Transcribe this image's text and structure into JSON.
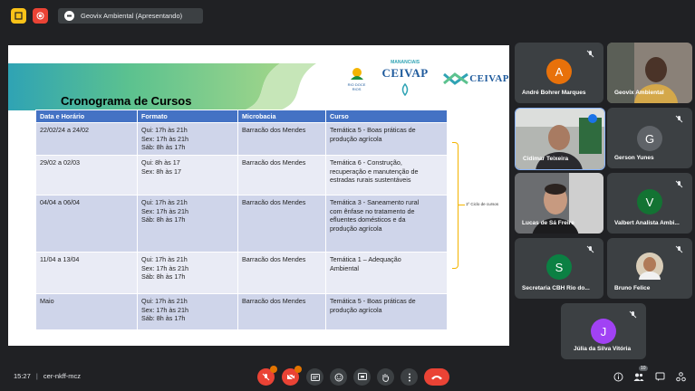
{
  "meeting": {
    "presenter_label": "Geovix Ambiental (Apresentando)",
    "time": "15:27",
    "code": "cer-nkff-mcz",
    "participant_count": "10"
  },
  "slide": {
    "title": "Cronograma de Cursos",
    "logos": {
      "rio_doce": "RIO DOCE RIOS",
      "mananciais": "MANANCIAIS",
      "ceivap1": "CEIVAP",
      "ceivap2": "CEIVAP"
    },
    "columns": [
      "Data e Horário",
      "Formato",
      "Microbacia",
      "Curso"
    ],
    "rows": [
      {
        "date": "22/02/24 a 24/02",
        "format": "Qui: 17h às 21h\nSex: 17h às 21h\nSáb: 8h às 17h",
        "basin": "Barracão dos Mendes",
        "course": "Temática 5 - Boas práticas de\nprodução agrícola"
      },
      {
        "date": "29/02 a 02/03",
        "format": "Qui: 8h às 17\nSex: 8h às 17",
        "basin": "Barracão dos Mendes",
        "course": "Temática 6 - Construção,\nrecuperação e manutenção de\nestradas rurais sustentáveis"
      },
      {
        "date": "04/04 a 06/04",
        "format": "Qui: 17h às 21h\nSex: 17h às 21h\nSáb: 8h às 17h",
        "basin": "Barracão dos Mendes",
        "course": "Temática 3 - Saneamento rural\ncom ênfase no tratamento de\nefluentes domésticos e da\nprodução agrícola"
      },
      {
        "date": "11/04 a 13/04",
        "format": "Qui: 17h às 21h\nSex: 17h às 21h\nSáb: 8h às 17h",
        "basin": "Barracão dos Mendes",
        "course": "Temática 1 – Adequação\nAmbiental"
      },
      {
        "date": "Maio",
        "format": "Qui: 17h às 21h\nSex: 17h às 21h\nSáb: 8h às 17h",
        "basin": "Barracão dos Mendes",
        "course": "Temática 5 - Boas práticas de\nprodução agrícola"
      }
    ],
    "bracket_label": "1º Ciclo de cursos"
  },
  "participants": [
    {
      "name": "André Bohrer Marques",
      "initial": "A",
      "color": "#e8710a"
    },
    {
      "name": "Geovix Ambiental",
      "initial": "",
      "color": ""
    },
    {
      "name": "Cidimar Teixeira",
      "initial": "",
      "color": ""
    },
    {
      "name": "Gerson Yunes",
      "initial": "G",
      "color": "#5f6368"
    },
    {
      "name": "Lucas de Sá Freire",
      "initial": "",
      "color": ""
    },
    {
      "name": "Valbert Analista Ambi...",
      "initial": "V",
      "color": "#137333"
    },
    {
      "name": "Secretaria CBH Rio do...",
      "initial": "S",
      "color": "#0b8043"
    },
    {
      "name": "Bruno Felice",
      "initial": "",
      "color": ""
    },
    {
      "name": "Júlia da Silva Vitória",
      "initial": "J",
      "color": "#a142f4"
    }
  ]
}
